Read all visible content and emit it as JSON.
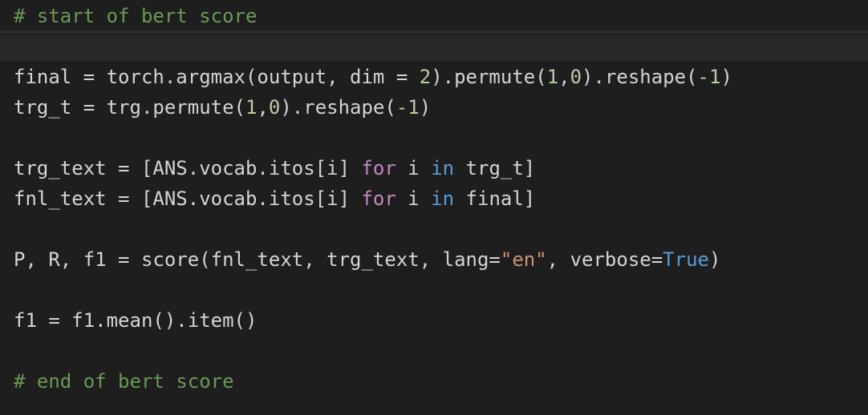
{
  "editor": {
    "lines": [
      [
        {
          "t": "# start of bert score",
          "k": "comment"
        }
      ],
      [
        {
          "t": "final = torch.argmax(output, dim = ",
          "k": "default"
        },
        {
          "t": "2",
          "k": "number"
        },
        {
          "t": ").permute(",
          "k": "default"
        },
        {
          "t": "1",
          "k": "number"
        },
        {
          "t": ",",
          "k": "default"
        },
        {
          "t": "0",
          "k": "number"
        },
        {
          "t": ").reshape(",
          "k": "default"
        },
        {
          "t": "-1",
          "k": "number"
        },
        {
          "t": ")",
          "k": "default"
        }
      ],
      [
        {
          "t": "trg_t = trg.permute(",
          "k": "default"
        },
        {
          "t": "1",
          "k": "number"
        },
        {
          "t": ",",
          "k": "default"
        },
        {
          "t": "0",
          "k": "number"
        },
        {
          "t": ").reshape(",
          "k": "default"
        },
        {
          "t": "-1",
          "k": "number"
        },
        {
          "t": ")",
          "k": "default"
        }
      ],
      [
        {
          "t": "trg_text = [ANS.vocab.itos[i] ",
          "k": "default"
        },
        {
          "t": "for",
          "k": "keyword"
        },
        {
          "t": " i ",
          "k": "default"
        },
        {
          "t": "in",
          "k": "op"
        },
        {
          "t": " trg_t]",
          "k": "default"
        }
      ],
      [
        {
          "t": "fnl_text = [ANS.vocab.itos[i] ",
          "k": "default"
        },
        {
          "t": "for",
          "k": "keyword"
        },
        {
          "t": " i ",
          "k": "default"
        },
        {
          "t": "in",
          "k": "op"
        },
        {
          "t": " final]",
          "k": "default"
        }
      ],
      [
        {
          "t": "P, R, f1 = score(fnl_text, trg_text, lang=",
          "k": "default"
        },
        {
          "t": "\"en\"",
          "k": "string"
        },
        {
          "t": ", verbose=",
          "k": "default"
        },
        {
          "t": "True",
          "k": "const"
        },
        {
          "t": ")",
          "k": "default"
        }
      ],
      [
        {
          "t": "f1 = f1.mean().item()",
          "k": "default"
        }
      ],
      [
        {
          "t": "# end of bert score",
          "k": "comment"
        }
      ]
    ]
  }
}
